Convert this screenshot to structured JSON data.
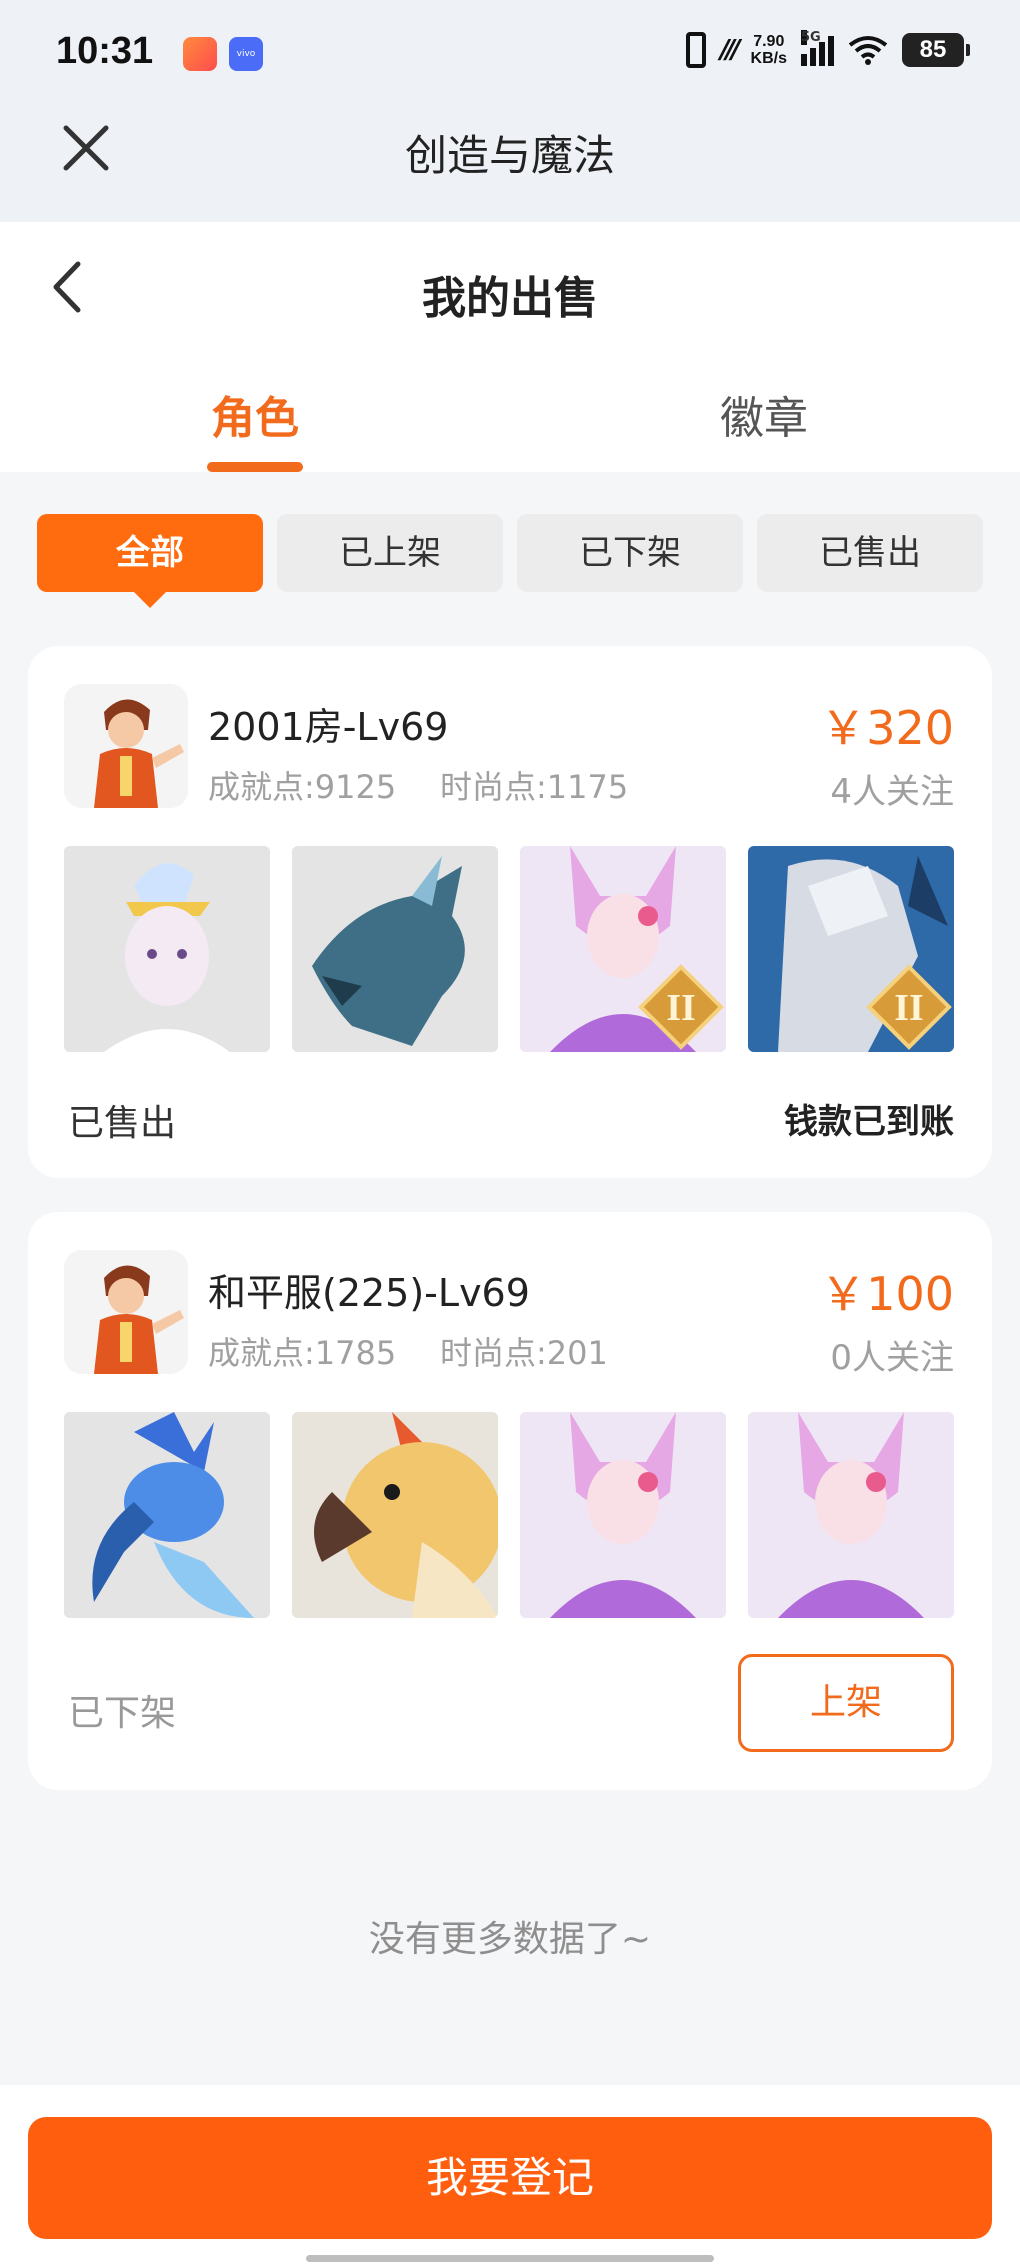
{
  "status_bar": {
    "time": "10:31",
    "speed_top": "7.90",
    "speed_unit": "KB/s",
    "network": "5G",
    "battery": "85"
  },
  "app": {
    "title": "创造与魔法",
    "close_icon": "close-icon"
  },
  "page": {
    "title": "我的出售",
    "back_icon": "chevron-left-icon"
  },
  "tabs": [
    {
      "label": "角色",
      "active": true
    },
    {
      "label": "徽章",
      "active": false
    }
  ],
  "filters": [
    {
      "label": "全部",
      "active": true
    },
    {
      "label": "已上架",
      "active": false
    },
    {
      "label": "已下架",
      "active": false
    },
    {
      "label": "已售出",
      "active": false
    }
  ],
  "listings": [
    {
      "name": "2001房-Lv69",
      "achievement": "成就点:9125",
      "fashion": "时尚点:1175",
      "price": "￥320",
      "watchers": "4人关注",
      "status": "已售出",
      "note": "钱款已到账"
    },
    {
      "name": "和平服(225)-Lv69",
      "achievement": "成就点:1785",
      "fashion": "时尚点:201",
      "price": "￥100",
      "watchers": "0人关注",
      "status": "已下架",
      "action": "上架"
    }
  ],
  "footer": {
    "no_more": "没有更多数据了~",
    "register": "我要登记"
  },
  "colors": {
    "accent": "#f26a1b",
    "button": "#ff5e0e"
  }
}
